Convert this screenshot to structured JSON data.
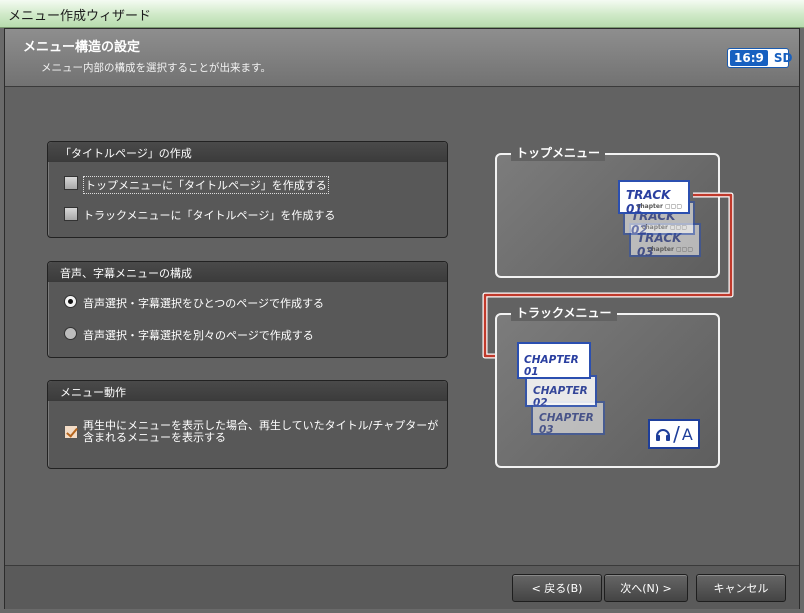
{
  "window": {
    "title": "メニュー作成ウィザード"
  },
  "header": {
    "title": "メニュー構造の設定",
    "subtitle": "メニュー内部の構成を選択することが出来ます。",
    "badge_ratio": "16:9",
    "badge_format": "SD"
  },
  "groups": {
    "title_page": {
      "heading": "「タイトルページ」の作成",
      "options": [
        {
          "label": "トップメニューに「タイトルページ」を作成する",
          "checked": false
        },
        {
          "label": "トラックメニューに「タイトルページ」を作成する",
          "checked": false
        }
      ]
    },
    "audio_subtitle": {
      "heading": "音声、字幕メニューの構成",
      "options": [
        {
          "label": "音声選択・字幕選択をひとつのページで作成する",
          "selected": true
        },
        {
          "label": "音声選択・字幕選択を別々のページで作成する",
          "selected": false
        }
      ]
    },
    "menu_action": {
      "heading": "メニュー動作",
      "option_line1": "再生中にメニューを表示した場合、再生していたタイトル/チャプターが",
      "option_line2": "含まれるメニューを表示する",
      "checked": true
    }
  },
  "preview": {
    "top_menu_label": "トップメニュー",
    "track_menu_label": "トラックメニュー",
    "tracks": [
      "TRACK 01",
      "TRACK 02",
      "TRACK 03"
    ],
    "track_sub": "chapter ▢▢▢",
    "chapters": [
      "CHAPTER 01",
      "CHAPTER 02",
      "CHAPTER 03"
    ],
    "audio_icon_letter": "A"
  },
  "footer": {
    "back_label": "< 戻る(B)",
    "next_label": "次へ(N) >",
    "cancel_label": "キャンセル"
  },
  "colors": {
    "accent": "#1760c0",
    "arrow": "#c0392b",
    "card_border": "#2b4fb0"
  }
}
